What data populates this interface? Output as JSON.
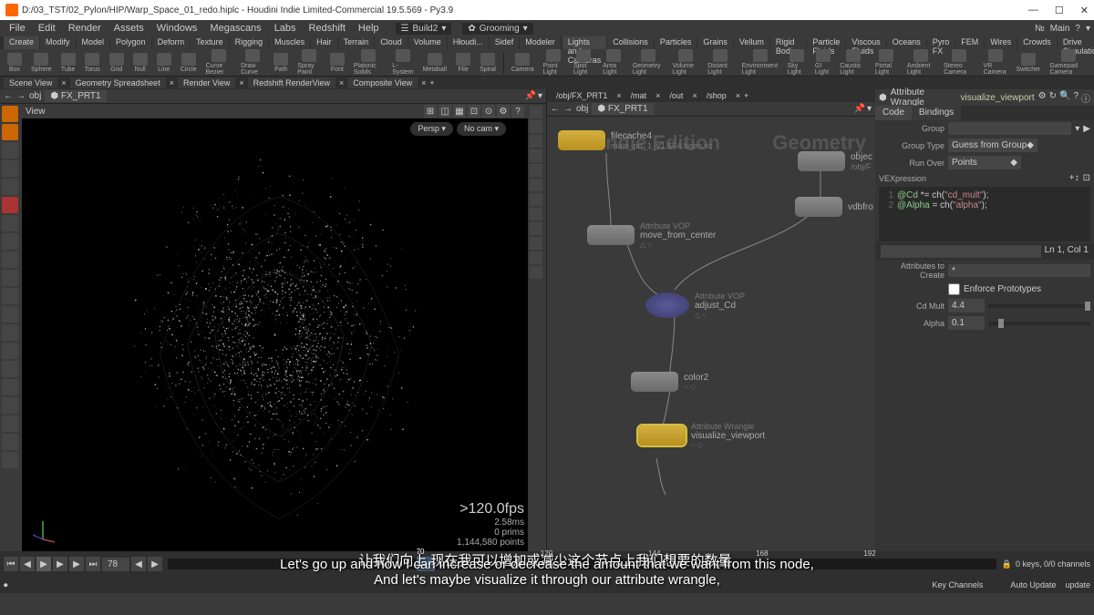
{
  "window": {
    "title": "D:/03_TST/02_Pylon/HIP/Warp_Space_01_redo.hiplc - Houdini Indie Limited-Commercial 19.5.569 - Py3.9",
    "min": "—",
    "max": "☐",
    "close": "✕"
  },
  "menu": [
    "File",
    "Edit",
    "Render",
    "Assets",
    "Windows",
    "Megascans",
    "Labs",
    "Redshift",
    "Help"
  ],
  "desktops": {
    "build": "Build2",
    "groom": "Grooming"
  },
  "header_right": {
    "prefix": "№",
    "main": "Main"
  },
  "shelf_tabs_left": [
    "Create",
    "Modify",
    "Model",
    "Polygon",
    "Deform",
    "Texture",
    "Rigging",
    "Muscles",
    "Hair",
    "Terrain",
    "Cloud",
    "Volume",
    "Hłoudi...",
    "Sidef",
    "Modeler"
  ],
  "shelf_tabs_right": [
    "Lights and Cameras",
    "Collisions",
    "Particles",
    "Grains",
    "Vellum",
    "Rigid Bodies",
    "Particle Fluids",
    "Viscous Fluids",
    "Oceans",
    "Pyro FX",
    "FEM",
    "Wires",
    "Crowds",
    "Drive Simulation"
  ],
  "tools_left": [
    "Box",
    "Sphere",
    "Tube",
    "Torus",
    "Grid",
    "Null",
    "Line",
    "Circle",
    "Curve Bezier",
    "Draw Curve",
    "Path",
    "Spray Paint",
    "Font",
    "Platonic Solids",
    "L-System",
    "Metaball",
    "File",
    "Spiral"
  ],
  "tools_right": [
    "Camera",
    "Point Light",
    "Spot Light",
    "Area Light",
    "Geometry Light",
    "Volume Light",
    "Distant Light",
    "Environment Light",
    "Sky Light",
    "GI Light",
    "Caustic Light",
    "Portal Light",
    "Ambient Light",
    "Stereo Camera",
    "VR Camera",
    "Switcher",
    "Gamepad Camera"
  ],
  "pane_tabs": [
    "Scene View",
    "Geometry Spreadsheet",
    "Render View",
    "Redshift RenderView",
    "Composite View"
  ],
  "path": {
    "obj": "obj",
    "node": "FX_PRT1"
  },
  "view_label": "View",
  "viewport": {
    "persp": "Persp",
    "nocam": "No cam",
    "fps": ">120.0fps",
    "ms": "2.58ms",
    "prims": "0   prims",
    "points": "1,144,580 points"
  },
  "context_bar": [
    "/obj/FX_PRT1",
    "/mat",
    "/out",
    "/shop"
  ],
  "network_path": {
    "obj": "obj",
    "node": "FX_PRT1"
  },
  "bg_labels": {
    "indie": "indie Edition",
    "geo": "Geometry"
  },
  "nodes": {
    "filecache": {
      "name": "filecache4",
      "sub": "main_prt_1_v1.$F4.bgeo.sc"
    },
    "objectmerge": {
      "name": "objec"
    },
    "vdbfrom": {
      "name": "vdbfro"
    },
    "movecenter": {
      "type": "Attribute VOP",
      "name": "move_from_center"
    },
    "adjustcd": {
      "type": "Attribute VOP",
      "name": "adjust_Cd"
    },
    "color2": {
      "name": "color2"
    },
    "vizvp": {
      "type": "Attribute Wrangle",
      "name": "visualize_viewport",
      "path": "/obj/F"
    }
  },
  "parm": {
    "optype": "Attribute Wrangle",
    "opname": "visualize_viewport",
    "tabs": [
      "Code",
      "Bindings"
    ],
    "group_label": "Group",
    "group_value": "",
    "grouptype_label": "Group Type",
    "grouptype_value": "Guess from Group",
    "runover_label": "Run Over",
    "runover_value": "Points",
    "vex_label": "VEXpression",
    "code": [
      {
        "n": "1",
        "t": "@Cd *= ch(\"cd_mult\");"
      },
      {
        "n": "2",
        "t": "@Alpha = ch(\"alpha\");"
      }
    ],
    "status": "Ln 1, Col 1",
    "attrs_label": "Attributes to Create",
    "attrs_value": "*",
    "enforce": "Enforce Prototypes",
    "cdmult_label": "Cd Mult",
    "cdmult_value": "4.4",
    "alpha_label": "Alpha",
    "alpha_value": "0.1"
  },
  "timeline": {
    "frame": "78",
    "cursor_frame": "70",
    "ticks": [
      "120",
      "144",
      "168",
      "192"
    ],
    "keys": "0 keys, 0/0 channels",
    "bottom": "Key Channels"
  },
  "statusbar": {
    "auto": "Auto Update",
    "update": "update"
  },
  "subtitle": {
    "cn": "让我们向上,现在我可以增加或减少这个节点上我们想要的数量,",
    "en": "Let's go up and now I can increase or decrease the amount that we want from this node, And let's maybe visualize it through our attribute wrangle,"
  }
}
